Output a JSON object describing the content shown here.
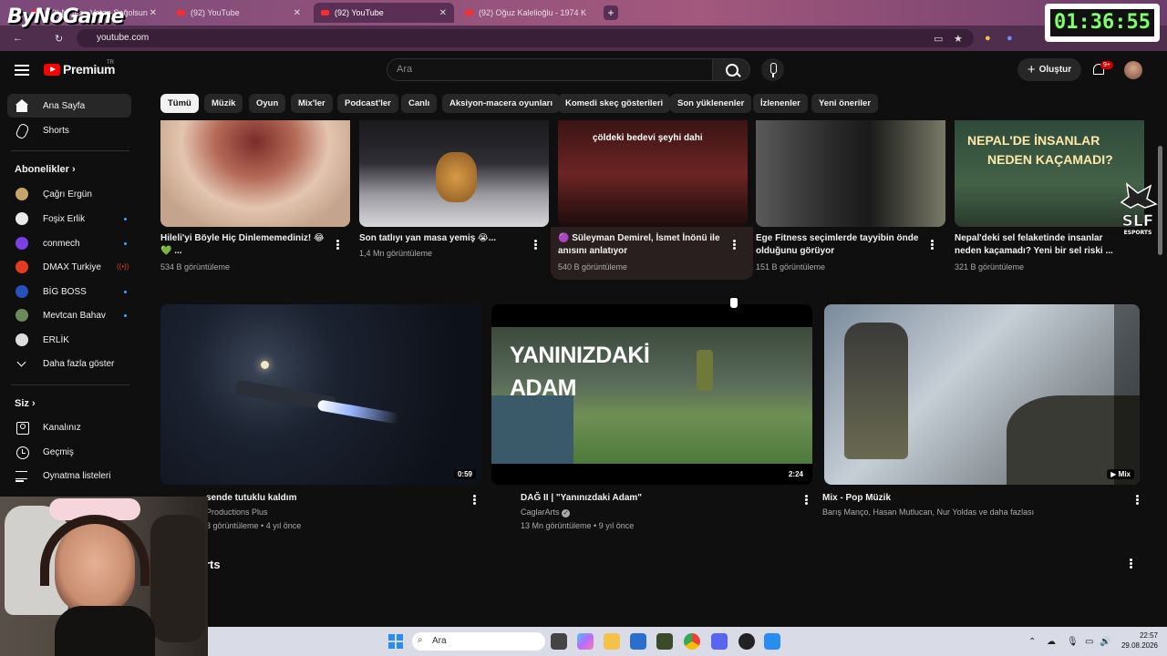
{
  "browser": {
    "tabs": [
      {
        "label": "(92) Nefes - Vatan Sağolsun | M"
      },
      {
        "label": "(92) YouTube"
      },
      {
        "label": "(92) YouTube"
      },
      {
        "label": "(92) Oğuz Kalelioğlu - 1974 K"
      }
    ],
    "url": "youtube.com"
  },
  "overlay": {
    "logo_text": "ByNoGame",
    "timer": "01:36:55"
  },
  "header": {
    "brand": "Premium",
    "region": "TR",
    "search_placeholder": "Ara",
    "create_label": "Oluştur",
    "notification_count": "9+"
  },
  "sidebar": {
    "main": [
      {
        "label": "Ana Sayfa",
        "icon": "home-icon"
      },
      {
        "label": "Shorts",
        "icon": "shorts-icon"
      }
    ],
    "subscriptions_heading": "Abonelikler",
    "subscriptions": [
      {
        "label": "Çağrı Ergün",
        "color": "#c9a46a"
      },
      {
        "label": "Foşix Erlik",
        "color": "#e8e8e8"
      },
      {
        "label": "conmech",
        "color": "#7b3fe4"
      },
      {
        "label": "DMAX Turkiye",
        "color": "#e23b1f"
      },
      {
        "label": "BİG BOSS",
        "color": "#2a4fbf"
      },
      {
        "label": "Mevtcan Bahav",
        "color": "#6a8a5a"
      },
      {
        "label": "ERLİK",
        "color": "#ddd"
      }
    ],
    "show_more": "Daha fazla göster",
    "you_heading": "Siz",
    "you_items": [
      {
        "label": "Kanalınız",
        "icon": "channel-icon"
      },
      {
        "label": "Geçmiş",
        "icon": "history-icon"
      },
      {
        "label": "Oynatma listeleri",
        "icon": "playlist-icon"
      }
    ]
  },
  "chips": [
    "Tümü",
    "Müzik",
    "Oyun",
    "Mix'ler",
    "Podcast'ler",
    "Canlı",
    "Aksiyon-macera oyunları",
    "Komedi skeç gösterileri",
    "Son yüklenenler",
    "İzlenenler",
    "Yeni öneriler"
  ],
  "row1": [
    {
      "title_l1": "Hileli'yi Böyle Hiç Dinlememediniz! 😂",
      "title_l2": "💚 ...",
      "meta": "534 B görüntüleme"
    },
    {
      "title_l1": "Son tatlıyı yan masa yemiş 😭...",
      "title_l2": "",
      "meta": "1,4 Mn görüntüleme"
    },
    {
      "title_l1": "🟣 Süleyman Demirel, İsmet İnönü ile",
      "title_l2": "anısını anlatıyor",
      "meta": "540 B görüntüleme",
      "overlay": "çöldeki bedevi şeyhi dahi"
    },
    {
      "title_l1": "Ege Fitness seçimlerde tayyibin önde",
      "title_l2": "olduğunu görüyor",
      "meta": "151 B görüntüleme"
    },
    {
      "title_l1": "Nepal'deki sel felaketinde insanlar",
      "title_l2": "neden kaçamadı? Yeni bir sel riski ...",
      "meta": "321 B görüntüleme",
      "overlay_l1": "NEPAL'DE İNSANLAR",
      "overlay_l2": "NEDEN KAÇAMADI?"
    }
  ],
  "row2": [
    {
      "title": "sende tutuklu kaldım",
      "channel": "Productions Plus",
      "meta": "3 görüntüleme • 4 yıl önce",
      "duration": "0:59"
    },
    {
      "title": "DAĞ II | \"Yanınızdaki Adam\"",
      "channel": "CaglarArts",
      "meta": "13 Mn görüntüleme • 9 yıl önce",
      "duration": "2:24",
      "overlay_l1": "YANINIZDAKİ",
      "overlay_l2": "ADAM"
    },
    {
      "title": "Mix - Pop Müzik",
      "channel": "Barış Manço, Hasan Mutlucan, Nur Yoldas ve daha fazlası",
      "meta": "",
      "duration": "Mix"
    }
  ],
  "shorts_heading": "rts",
  "taskbar": {
    "search_label": "Ara",
    "time": "22:57",
    "date": "29.08.2026"
  },
  "slf_logo_text": "SLF ESPORTS"
}
